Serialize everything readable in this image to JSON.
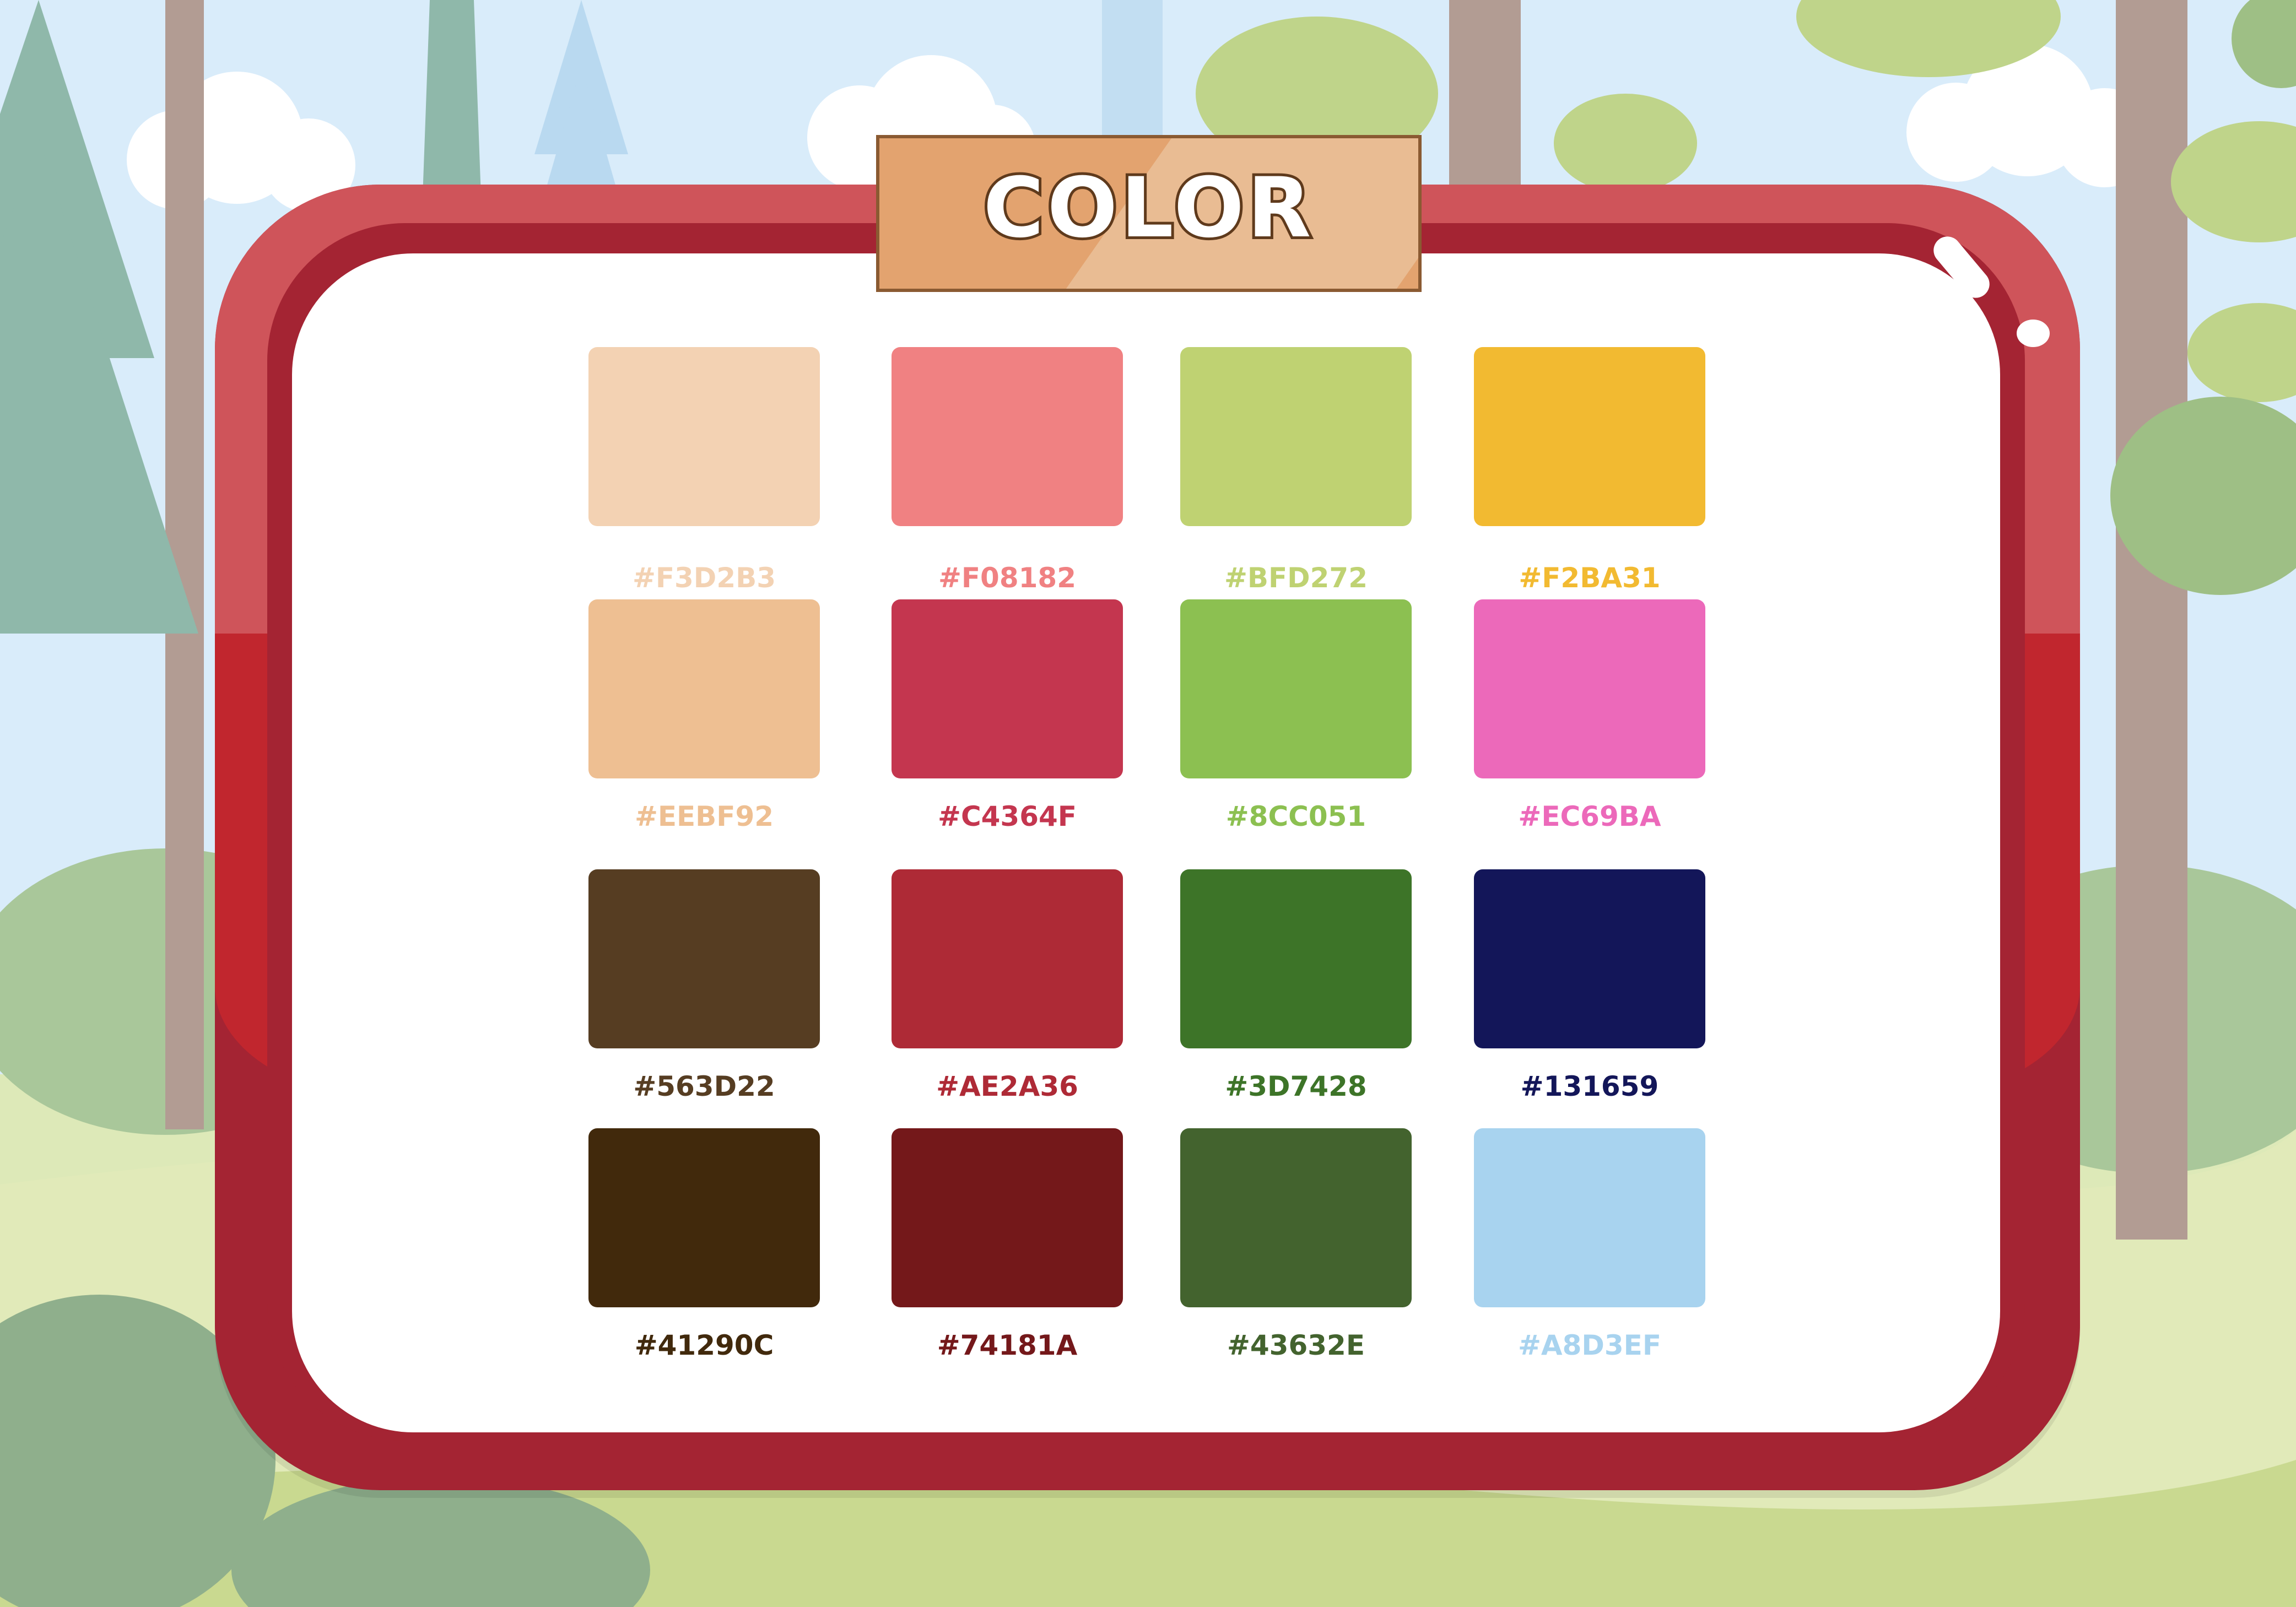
{
  "title": "COLOR",
  "palette": [
    {
      "hex": "#F3D2B3",
      "label": "#F3D2B3"
    },
    {
      "hex": "#F08182",
      "label": "#F08182"
    },
    {
      "hex": "#BFD272",
      "label": "#BFD272"
    },
    {
      "hex": "#F2BA31",
      "label": "#F2BA31"
    },
    {
      "hex": "#EEBF92",
      "label": "#EEBF92"
    },
    {
      "hex": "#C4364F",
      "label": "#C4364F"
    },
    {
      "hex": "#8CC051",
      "label": "#8CC051"
    },
    {
      "hex": "#EC69BA",
      "label": "#EC69BA"
    },
    {
      "hex": "#563D22",
      "label": "#563D22"
    },
    {
      "hex": "#AE2A36",
      "label": "#AE2A36"
    },
    {
      "hex": "#3D7428",
      "label": "#3D7428"
    },
    {
      "hex": "#131659",
      "label": "#131659"
    },
    {
      "hex": "#41290C",
      "label": "#41290C"
    },
    {
      "hex": "#74181A",
      "label": "#74181A"
    },
    {
      "hex": "#43632E",
      "label": "#43632E"
    },
    {
      "hex": "#A8D3EF",
      "label": "#A8D3EF"
    }
  ]
}
